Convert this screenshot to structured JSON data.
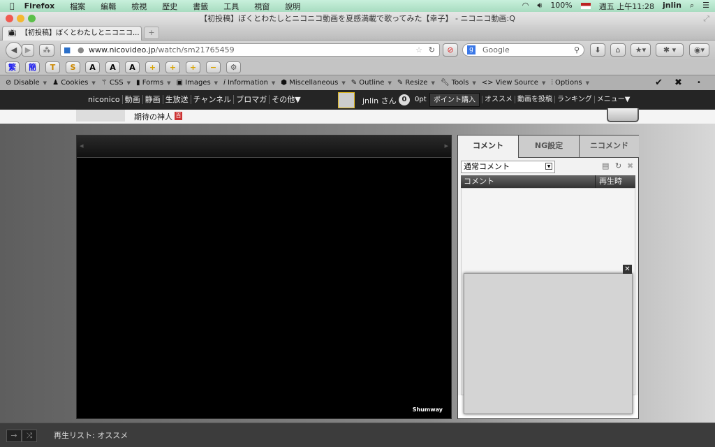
{
  "menubar": {
    "app": "Firefox",
    "items": [
      "檔案",
      "編輯",
      "檢視",
      "歷史",
      "書籤",
      "工具",
      "視窗",
      "說明"
    ],
    "battery": "100%",
    "clock": "週五 上午11:28",
    "user": "jnlin"
  },
  "window": {
    "title": "【初投稿】ぼくとわたしとニコニコ動画を夏感満載で歌ってみた【幸子】 - ニコニコ動画:Q"
  },
  "tabs": [
    {
      "label": "【初投稿】ぼくとわたしとニコニコ..."
    }
  ],
  "nav": {
    "url_host": "www.nicovideo.jp",
    "url_path": "/watch/sm21765459",
    "search_placeholder": "Google"
  },
  "toolbar2": {
    "buttons": [
      "繁",
      "簡",
      "T",
      "S",
      "A",
      "A",
      "A",
      "+",
      "+",
      "+",
      "−",
      "⚙"
    ]
  },
  "webdev": {
    "items": [
      "Disable",
      "Cookies",
      "CSS",
      "Forms",
      "Images",
      "Information",
      "Miscellaneous",
      "Outline",
      "Resize",
      "Tools",
      "View Source",
      "Options"
    ]
  },
  "nico": {
    "nav": [
      "niconico",
      "動画",
      "静画",
      "生放送",
      "チャンネル",
      "ブロマガ",
      "その他▼"
    ],
    "user": "jnlin さん",
    "points_badge": "0",
    "points": "0pt",
    "buy_points": "ポイント購入",
    "right_nav": [
      "オススメ",
      "動画を投稿",
      "ランキング",
      "メニュー▼"
    ],
    "tag": "期待の神人",
    "tag_icon": "百"
  },
  "player": {
    "watermark": "Shumway"
  },
  "comments": {
    "tabs": [
      "コメント",
      "NG設定",
      "ニコメンド"
    ],
    "filter": "通常コメント",
    "col_comment": "コメント",
    "col_time": "再生時"
  },
  "playlist": {
    "label": "再生リスト: オススメ"
  }
}
